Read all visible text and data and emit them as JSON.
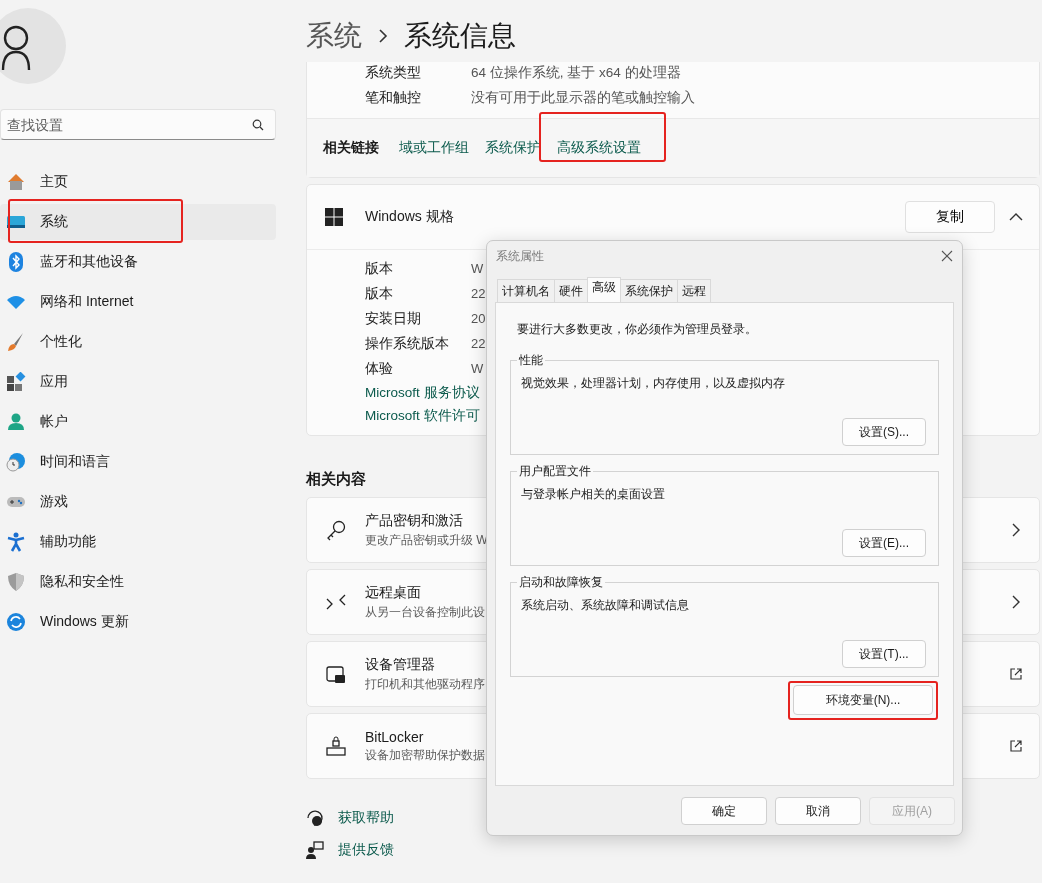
{
  "search": {
    "placeholder": "查找设置"
  },
  "sidebar": {
    "items": [
      {
        "label": "主页",
        "kind": "home",
        "selected": false,
        "highlighted": false
      },
      {
        "label": "系统",
        "kind": "system",
        "selected": true,
        "highlighted": true
      },
      {
        "label": "蓝牙和其他设备",
        "kind": "bluetooth",
        "selected": false,
        "highlighted": false
      },
      {
        "label": "网络和 Internet",
        "kind": "wifi",
        "selected": false,
        "highlighted": false
      },
      {
        "label": "个性化",
        "kind": "brush",
        "selected": false,
        "highlighted": false
      },
      {
        "label": "应用",
        "kind": "apps",
        "selected": false,
        "highlighted": false
      },
      {
        "label": "帐户",
        "kind": "account",
        "selected": false,
        "highlighted": false
      },
      {
        "label": "时间和语言",
        "kind": "time",
        "selected": false,
        "highlighted": false
      },
      {
        "label": "游戏",
        "kind": "gamepad",
        "selected": false,
        "highlighted": false
      },
      {
        "label": "辅助功能",
        "kind": "accessibility",
        "selected": false,
        "highlighted": false
      },
      {
        "label": "隐私和安全性",
        "kind": "shield",
        "selected": false,
        "highlighted": false
      },
      {
        "label": "Windows 更新",
        "kind": "update",
        "selected": false,
        "highlighted": false
      }
    ]
  },
  "breadcrumb": {
    "parent": "系统",
    "current": "系统信息"
  },
  "device_specs": {
    "rows": [
      {
        "label": "系统类型",
        "value": "64 位操作系统, 基于 x64 的处理器"
      },
      {
        "label": "笔和触控",
        "value": "没有可用于此显示器的笔或触控输入"
      }
    ],
    "related_links": {
      "label": "相关链接",
      "links": [
        {
          "text": "域或工作组",
          "highlighted": false
        },
        {
          "text": "系统保护",
          "highlighted": false
        },
        {
          "text": "高级系统设置",
          "highlighted": true
        }
      ]
    }
  },
  "windows_specs": {
    "title": "Windows 规格",
    "copy_button": "复制",
    "expanded": true,
    "rows": [
      {
        "label": "版本",
        "value": "W"
      },
      {
        "label": "版本",
        "value": "22"
      },
      {
        "label": "安装日期",
        "value": "20"
      },
      {
        "label": "操作系统版本",
        "value": "22"
      },
      {
        "label": "体验",
        "value": "W"
      }
    ],
    "links": [
      "Microsoft 服务协议",
      "Microsoft 软件许可"
    ]
  },
  "related_content": {
    "title": "相关内容",
    "items": [
      {
        "title": "产品密钥和激活",
        "description": "更改产品密钥或升级 W",
        "kind": "key"
      },
      {
        "title": "远程桌面",
        "description": "从另一台设备控制此设",
        "kind": "remote"
      },
      {
        "title": "设备管理器",
        "description": "打印机和其他驱动程序",
        "kind": "device"
      },
      {
        "title": "BitLocker",
        "description": "设备加密帮助保护数据",
        "kind": "lock"
      }
    ]
  },
  "help_links": [
    {
      "text": "获取帮助",
      "kind": "help"
    },
    {
      "text": "提供反馈",
      "kind": "feedback"
    }
  ],
  "dialog": {
    "title": "系统属性",
    "tabs": [
      {
        "label": "计算机名",
        "selected": false
      },
      {
        "label": "硬件",
        "selected": false
      },
      {
        "label": "高级",
        "selected": true
      },
      {
        "label": "系统保护",
        "selected": false
      },
      {
        "label": "远程",
        "selected": false
      }
    ],
    "notice": "要进行大多数更改，你必须作为管理员登录。",
    "groups": [
      {
        "title": "性能",
        "description": "视觉效果，处理器计划，内存使用，以及虚拟内存",
        "button": "设置(S)..."
      },
      {
        "title": "用户配置文件",
        "description": "与登录帐户相关的桌面设置",
        "button": "设置(E)..."
      },
      {
        "title": "启动和故障恢复",
        "description": "系统启动、系统故障和调试信息",
        "button": "设置(T)..."
      }
    ],
    "env_button": {
      "label": "环境变量(N)...",
      "highlighted": true
    },
    "buttons": [
      {
        "label": "确定",
        "disabled": false
      },
      {
        "label": "取消",
        "disabled": false
      },
      {
        "label": "应用(A)",
        "disabled": true
      }
    ]
  }
}
